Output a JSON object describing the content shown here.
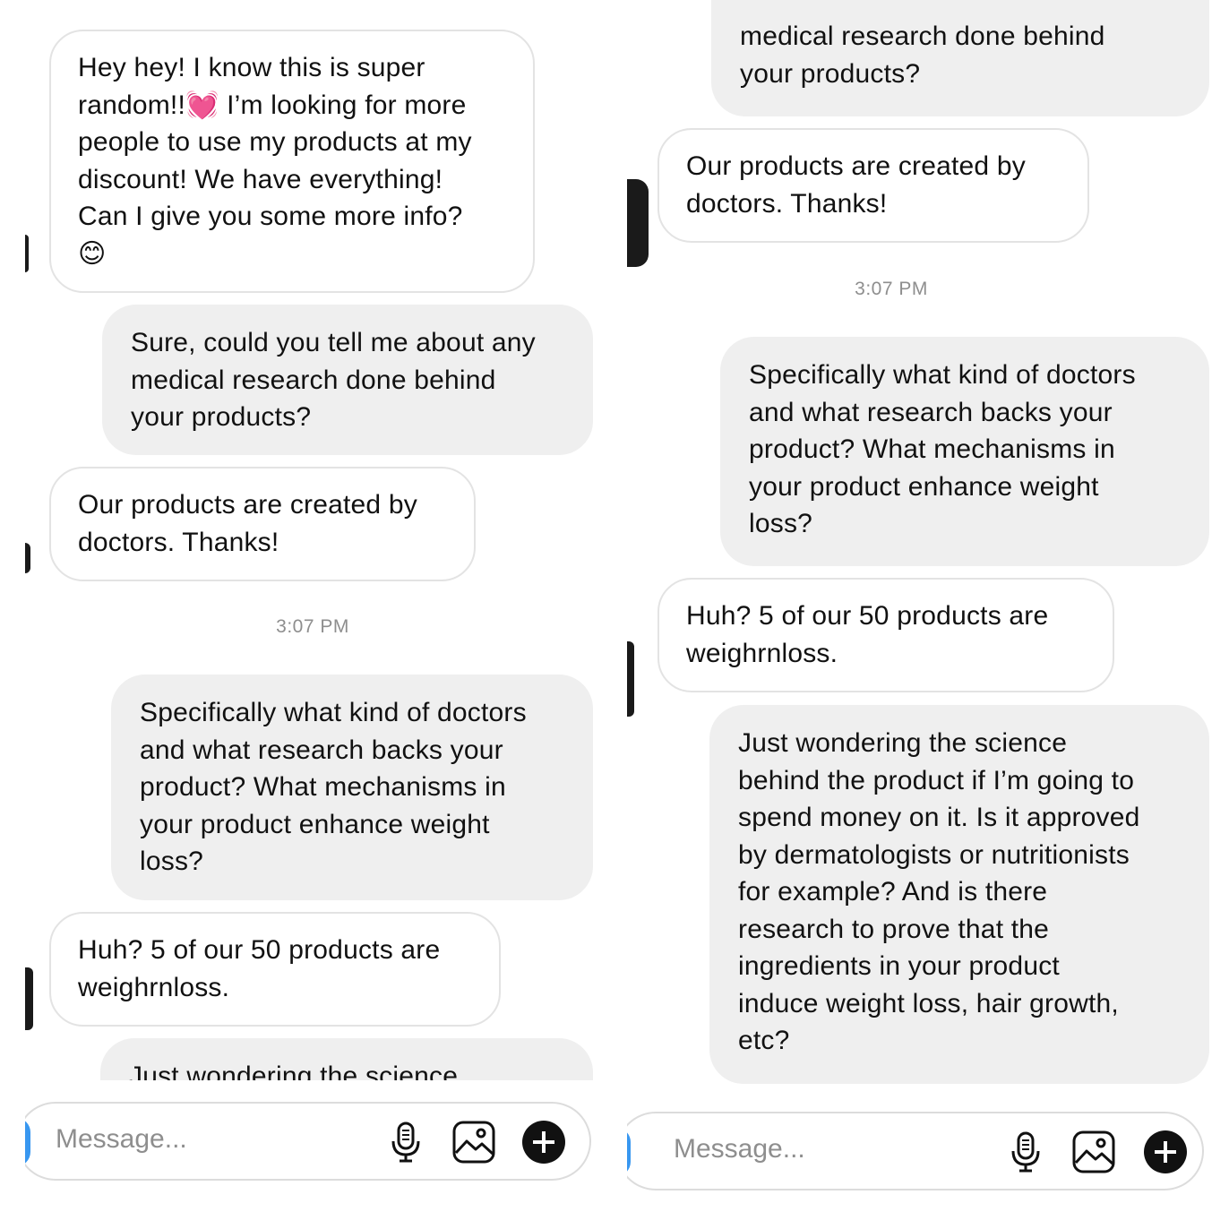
{
  "left_panel": {
    "messages": [
      {
        "from": "them",
        "text": "Hey hey! I know this is super\nrandom!!💓 I’m looking for more\npeople to use my products at my\ndiscount! We have everything!\nCan I give you some more info?\n😊"
      },
      {
        "from": "me",
        "text": "Sure, could you tell me about any\nmedical research done behind\nyour products?"
      },
      {
        "from": "them",
        "text": "Our products are created by\ndoctors. Thanks!"
      },
      {
        "from": "me",
        "text": "Specifically what kind of doctors\nand what research backs your\nproduct? What mechanisms in\nyour product enhance weight\nloss?"
      },
      {
        "from": "them",
        "text": "Huh? 5 of our 50 products are\nweighrnloss."
      },
      {
        "from": "me",
        "text": "Just wondering the science"
      }
    ],
    "timestamp": "3:07 PM",
    "composer": {
      "placeholder": "Message...",
      "icons": [
        "microphone-icon",
        "gallery-icon",
        "plus-icon"
      ]
    }
  },
  "right_panel": {
    "messages": [
      {
        "from": "me",
        "text": "medical research done behind\nyour products?"
      },
      {
        "from": "them",
        "text": "Our products are created by\ndoctors. Thanks!"
      },
      {
        "from": "me",
        "text": "Specifically what kind of doctors\nand what research backs your\nproduct? What mechanisms in\nyour product enhance weight\nloss?"
      },
      {
        "from": "them",
        "text": "Huh? 5 of our 50 products are\nweighrnloss."
      },
      {
        "from": "me",
        "text": "Just wondering the science\nbehind the product if I’m going to\nspend money on it. Is it approved\nby dermatologists or nutritionists\nfor example? And is there\nresearch to prove that the\ningredients in your product\ninduce weight loss, hair growth,\netc?"
      }
    ],
    "timestamp": "3:07 PM",
    "composer": {
      "placeholder": "Message...",
      "icons": [
        "microphone-icon",
        "gallery-icon",
        "plus-icon"
      ]
    }
  },
  "colors": {
    "sent_bubble": "#efefef",
    "received_border": "#e3e3e3",
    "timestamp": "#8e8e8e",
    "accent": "#3897f0"
  }
}
